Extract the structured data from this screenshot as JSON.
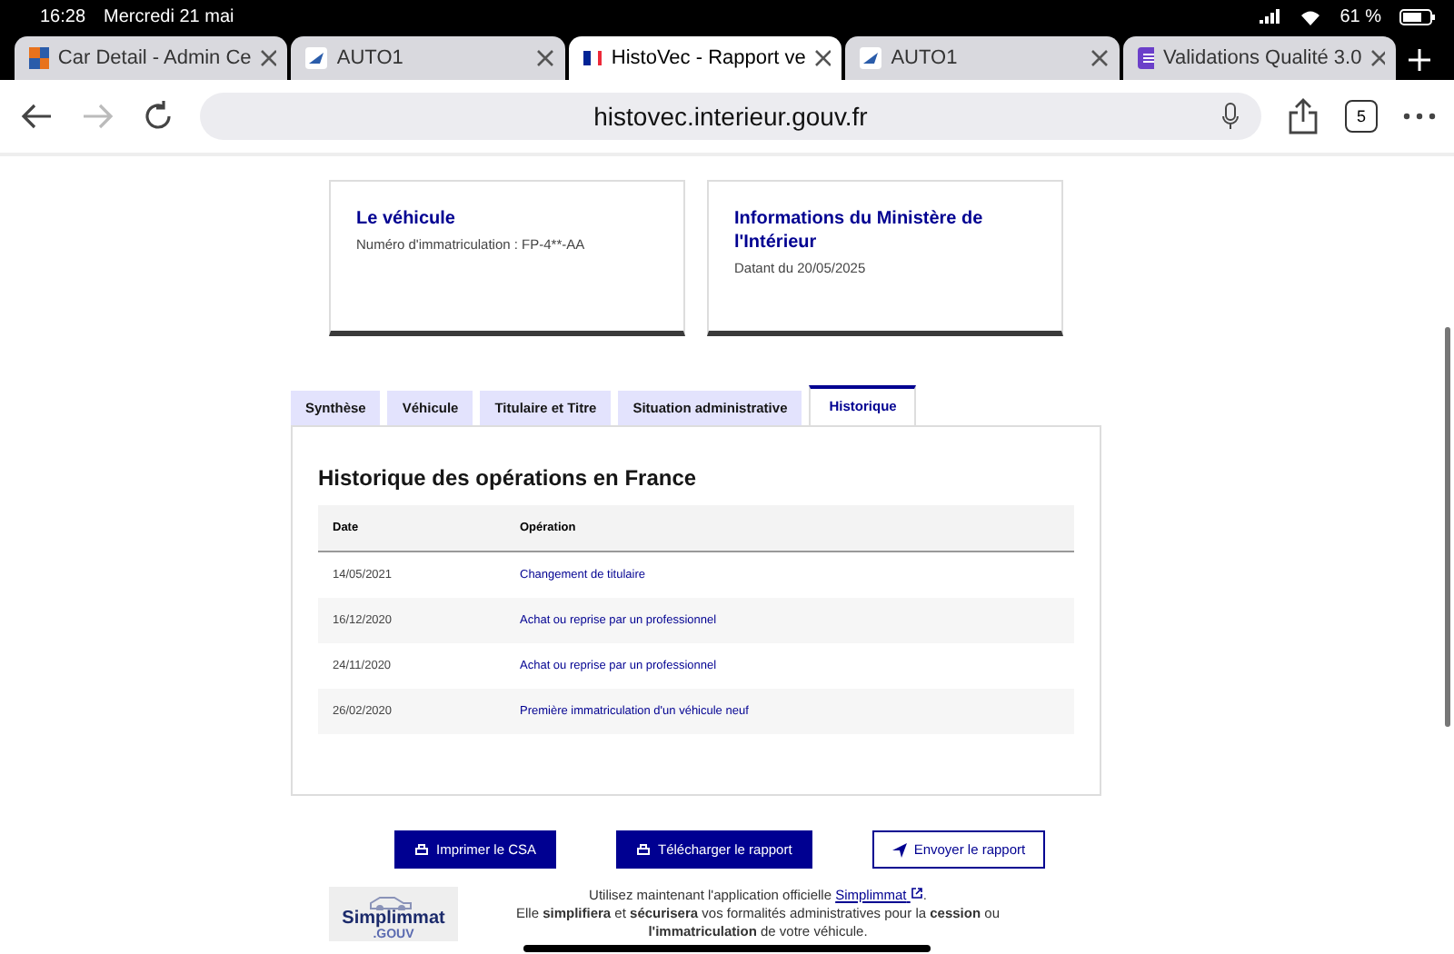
{
  "status_bar": {
    "time": "16:28",
    "date": "Mercredi 21 mai",
    "battery": "61 %"
  },
  "browser_tabs": [
    {
      "title": "Car Detail - Admin Ce",
      "selected": false
    },
    {
      "title": "AUTO1",
      "selected": false
    },
    {
      "title": "HistoVec - Rapport ve",
      "selected": true
    },
    {
      "title": "AUTO1",
      "selected": false
    },
    {
      "title": "Validations Qualité 3.0",
      "selected": false
    }
  ],
  "address_bar": {
    "url": "histovec.interieur.gouv.fr",
    "tab_count": "5"
  },
  "cards": [
    {
      "title": "Le véhicule",
      "text": "Numéro d'immatriculation : FP-4**-AA"
    },
    {
      "title": "Informations du Ministère de l'Intérieur",
      "text": "Datant du 20/05/2025"
    }
  ],
  "tabs": [
    {
      "label": "Synthèse",
      "selected": false
    },
    {
      "label": "Véhicule",
      "selected": false
    },
    {
      "label": "Titulaire et Titre",
      "selected": false
    },
    {
      "label": "Situation administrative",
      "selected": false
    },
    {
      "label": "Historique",
      "selected": true
    }
  ],
  "history": {
    "title": "Historique des opérations en France",
    "columns": [
      "Date",
      "Opération"
    ],
    "rows": [
      {
        "date": "14/05/2021",
        "operation": "Changement de titulaire"
      },
      {
        "date": "16/12/2020",
        "operation": "Achat ou reprise par un professionnel"
      },
      {
        "date": "24/11/2020",
        "operation": "Achat ou reprise par un professionnel"
      },
      {
        "date": "26/02/2020",
        "operation": "Première immatriculation d'un véhicule neuf"
      }
    ]
  },
  "actions": [
    {
      "label": "Imprimer le CSA",
      "kind": "primary"
    },
    {
      "label": "Télécharger le rapport",
      "kind": "primary"
    },
    {
      "label": "Envoyer le rapport",
      "kind": "secondary"
    }
  ],
  "promo": {
    "logo_name": "Simplimmat",
    "logo_domain": ".GOUV",
    "line_1": "Utilisez maintenant l'application officielle",
    "link": "Simplimmat",
    "line_1_end": ".",
    "line_2": "Elle **simplifiera** et **sécurisera** vos formalités administratives pour la **cession** ou",
    "line_3": "**l'immatriculation** de votre véhicule."
  }
}
